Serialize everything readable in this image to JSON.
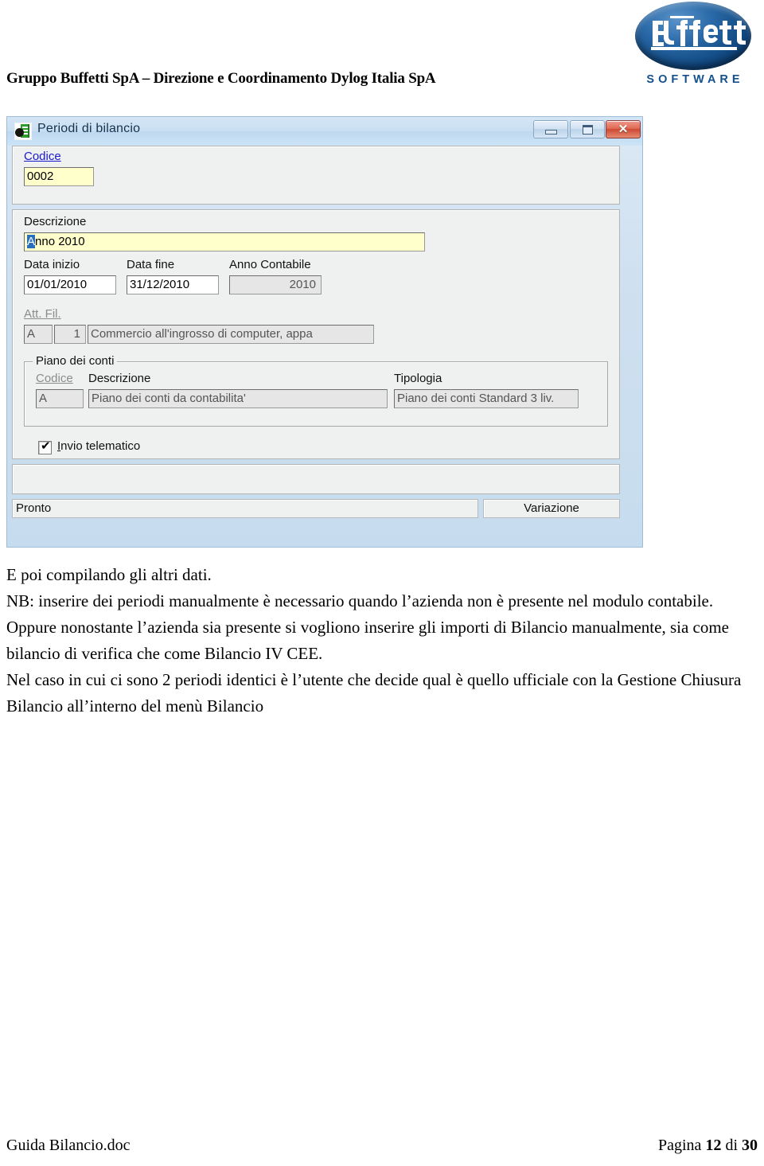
{
  "header": {
    "company_line": "Gruppo Buffetti SpA – Direzione e Coordinamento Dylog Italia SpA",
    "logo_wordmark": "Buffetti",
    "logo_subtitle": "SOFTWARE",
    "logo_color": "#14508c"
  },
  "window": {
    "title": "Periodi di bilancio",
    "icon": "app-icon",
    "buttons": {
      "minimize": "minimize",
      "maximize": "maximize",
      "close": "✕"
    },
    "codice": {
      "label": "Codice",
      "value": "0002"
    },
    "descrizione": {
      "label": "Descrizione",
      "value_selected": "A",
      "value_rest": "nno 2010",
      "value_full": "Anno 2010"
    },
    "data_inizio": {
      "label": "Data inizio",
      "value": "01/01/2010"
    },
    "data_fine": {
      "label": "Data fine",
      "value": "31/12/2010"
    },
    "anno_contabile": {
      "label": "Anno Contabile",
      "value": "2010"
    },
    "att_fil": {
      "label": "Att. Fil.",
      "att_value": "A",
      "fil_value": "1",
      "descr_value": "Commercio all'ingrosso di computer, appa"
    },
    "piano_dei_conti": {
      "title": "Piano dei conti",
      "col_codice": "Codice",
      "col_descrizione": "Descrizione",
      "col_tipologia": "Tipologia",
      "codice_value": "A",
      "descrizione_value": "Piano dei conti da contabilita'",
      "tipologia_value": "Piano dei conti Standard 3 liv."
    },
    "invio_telematico": {
      "label_accel": "I",
      "label_rest": "nvio telematico",
      "label": "Invio telematico",
      "checked": true,
      "check_glyph": "✔"
    },
    "statusbar": {
      "left": "Pronto",
      "right": "Variazione"
    }
  },
  "body": {
    "intro": "E poi compilando gli altri dati.",
    "note": "NB: inserire dei periodi manualmente è necessario quando l’azienda non è presente nel modulo contabile. Oppure nonostante l’azienda sia presente si vogliono inserire gli importi di Bilancio manualmente, sia come bilancio di verifica che come Bilancio IV CEE.",
    "note2": "Nel caso in cui ci sono 2 periodi identici è l’utente che decide qual è quello ufficiale con la Gestione Chiusura Bilancio all’interno del menù Bilancio"
  },
  "footer": {
    "left": "Guida Bilancio.doc",
    "right_prefix": "Pagina ",
    "page_number": "12",
    "right_middle": " di ",
    "page_total": "30"
  }
}
